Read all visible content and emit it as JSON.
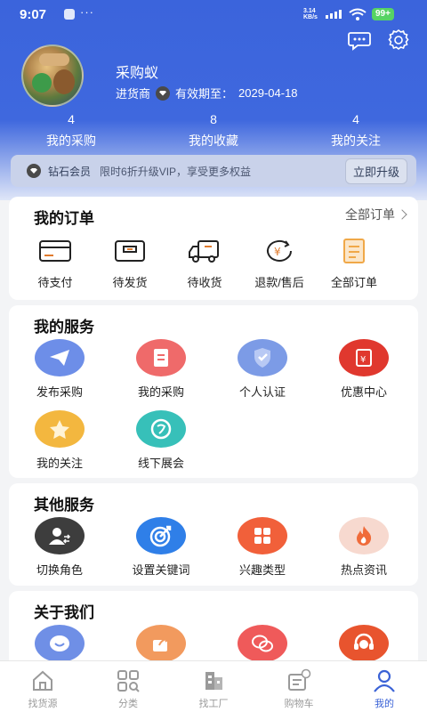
{
  "status_bar": {
    "time": "9:07",
    "dots": "···",
    "network_speed": "3.14 KB/s",
    "battery": "99+"
  },
  "profile": {
    "name": "采购蚁",
    "role": "进货商",
    "validity_label": "有效期至：",
    "validity_date": "2029-04-18"
  },
  "stats": [
    {
      "value": "4",
      "label": "我的采购"
    },
    {
      "value": "8",
      "label": "我的收藏"
    },
    {
      "value": "4",
      "label": "我的关注"
    }
  ],
  "vip": {
    "level": "钻石会员",
    "promo": "限时6折升级VIP，享受更多权益",
    "button": "立即升级"
  },
  "orders": {
    "title": "我的订单",
    "more": "全部订单",
    "items": [
      {
        "label": "待支付",
        "icon": "card-icon"
      },
      {
        "label": "待发货",
        "icon": "box-icon"
      },
      {
        "label": "待收货",
        "icon": "truck-icon"
      },
      {
        "label": "退款/售后",
        "icon": "refund-icon"
      },
      {
        "label": "全部订单",
        "icon": "orders-list-icon"
      }
    ]
  },
  "services": {
    "title": "我的服务",
    "items": [
      {
        "label": "发布采购",
        "icon": "paper-plane-icon",
        "color": "#6d8ee8"
      },
      {
        "label": "我的采购",
        "icon": "document-icon",
        "color": "#ef6a6a"
      },
      {
        "label": "个人认证",
        "icon": "shield-check-icon",
        "color": "#7c9be6"
      },
      {
        "label": "优惠中心",
        "icon": "coupon-icon",
        "color": "#e0382e"
      },
      {
        "label": "我的关注",
        "icon": "star-icon",
        "color": "#f3b73f"
      },
      {
        "label": "线下展会",
        "icon": "globe-icon",
        "color": "#37c0b9"
      }
    ]
  },
  "other_services": {
    "title": "其他服务",
    "items": [
      {
        "label": "切换角色",
        "icon": "switch-user-icon",
        "color": "#3d3d3d"
      },
      {
        "label": "设置关键词",
        "icon": "target-icon",
        "color": "#2f7fe8"
      },
      {
        "label": "兴趣类型",
        "icon": "apps-grid-icon",
        "color": "#f1603a"
      },
      {
        "label": "热点资讯",
        "icon": "flame-icon",
        "color": "#f7d9cf"
      }
    ]
  },
  "about": {
    "title": "关于我们",
    "items": [
      {
        "icon": "smile-chat-icon",
        "color": "#6f8fe6"
      },
      {
        "icon": "share-icon",
        "color": "#f29a5e"
      },
      {
        "icon": "wechat-icon",
        "color": "#ef5a5a"
      },
      {
        "icon": "customer-service-icon",
        "color": "#e8542e"
      }
    ]
  },
  "tabbar": [
    {
      "label": "找货源",
      "icon": "home-icon",
      "active": false
    },
    {
      "label": "分类",
      "icon": "category-icon",
      "active": false
    },
    {
      "label": "找工厂",
      "icon": "factory-icon",
      "active": false
    },
    {
      "label": "购物车",
      "icon": "cart-icon",
      "active": false
    },
    {
      "label": "我的",
      "icon": "profile-icon",
      "active": true
    }
  ]
}
